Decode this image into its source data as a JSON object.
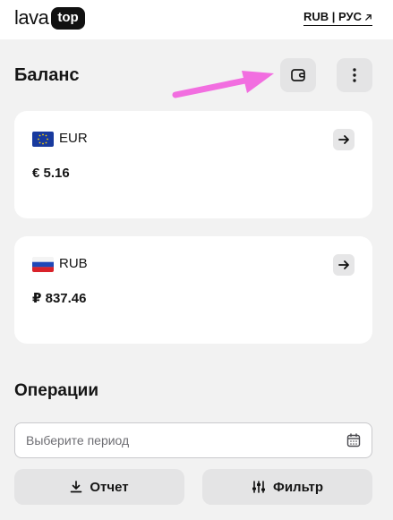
{
  "header": {
    "logo_text": "lava",
    "logo_pill": "top",
    "locale_label": "RUB | РУС",
    "locale_icon": "external-arrow-icon"
  },
  "balance": {
    "title": "Баланс",
    "wallet_icon": "wallet-icon",
    "more_icon": "more-vertical-icon",
    "annotation_color": "#f26ee0",
    "accounts": [
      {
        "currency": "EUR",
        "amount": "€ 5.16",
        "flag_icon": "eu-flag-icon"
      },
      {
        "currency": "RUB",
        "amount": "₽ 837.46",
        "flag_icon": "russia-flag-icon"
      }
    ]
  },
  "operations": {
    "title": "Операции",
    "period_placeholder": "Выберите период",
    "calendar_icon": "calendar-icon",
    "report_label": "Отчет",
    "filter_label": "Фильтр"
  },
  "colors": {
    "page_bg": "#f2f2f2",
    "card_bg": "#ffffff",
    "button_bg": "#e4e4e5",
    "text": "#151515"
  }
}
